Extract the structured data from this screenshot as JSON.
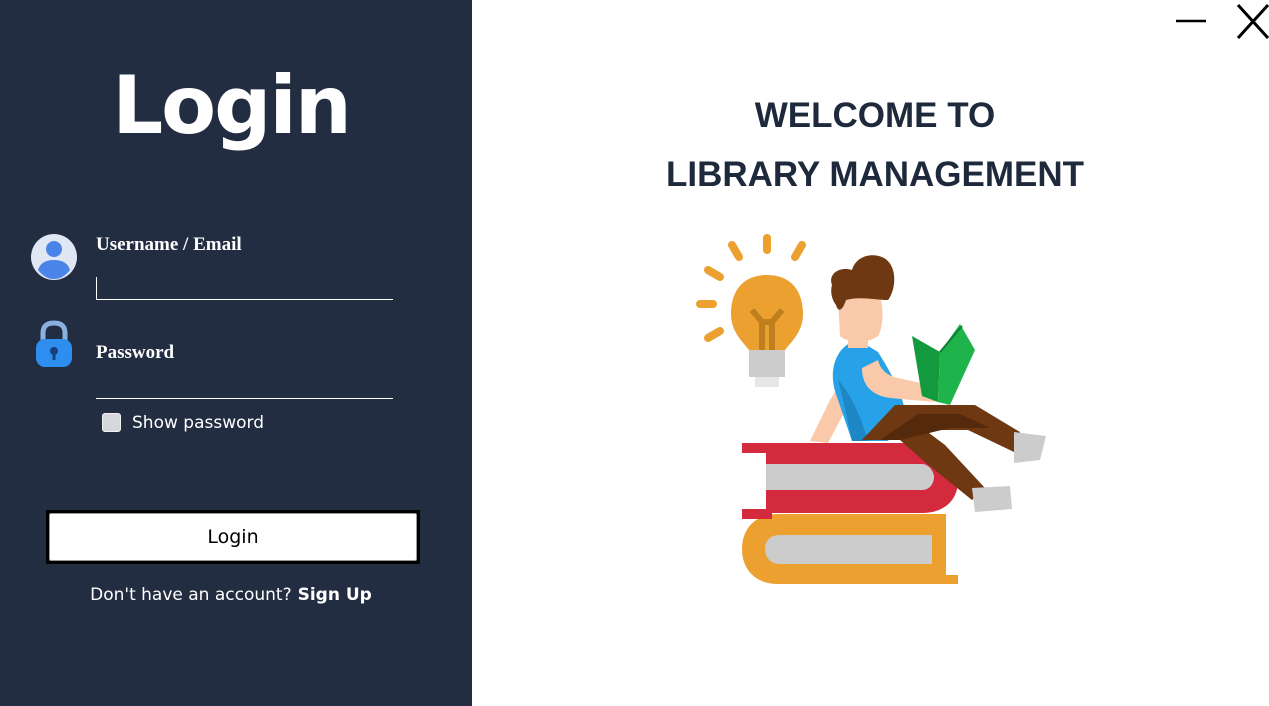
{
  "window": {
    "minimize_icon": "minimize-icon",
    "close_icon": "close-icon"
  },
  "login_panel": {
    "title": "Login",
    "username": {
      "label": "Username / Email",
      "value": "",
      "icon": "user-icon"
    },
    "password": {
      "label": "Password",
      "value": "",
      "icon": "lock-icon"
    },
    "show_password": {
      "label": "Show password",
      "checked": false
    },
    "login_button": "Login",
    "signup_prompt": "Don't have an account?",
    "signup_link": "Sign Up"
  },
  "welcome": {
    "line1": "WELCOME TO",
    "line2": "LIBRARY MANAGEMENT",
    "illustration": "reading-on-books-illustration"
  },
  "colors": {
    "panel_bg": "#232d42",
    "heading_text": "#1e2a3c",
    "book_red": "#d42a3d",
    "book_orange": "#eba030",
    "bulb": "#eba030",
    "shirt": "#27a2e8",
    "book_green": "#139a3e"
  }
}
